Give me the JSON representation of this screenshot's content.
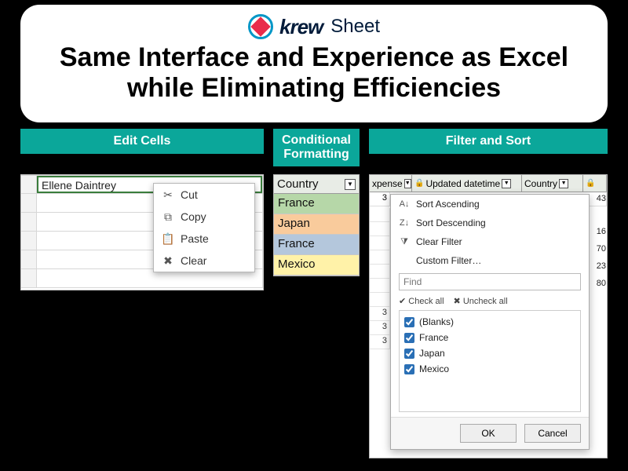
{
  "logo": {
    "brand": "krew",
    "suffix": "Sheet"
  },
  "headline": "Same Interface and Experience as Excel while Eliminating Efficiencies",
  "labels": {
    "edit": "Edit Cells",
    "cond": "Conditional Formatting",
    "filter": "Filter and Sort"
  },
  "edit": {
    "cell_value": "Ellene Daintrey",
    "menu": {
      "cut": "Cut",
      "copy": "Copy",
      "paste": "Paste",
      "clear": "Clear"
    }
  },
  "cond": {
    "header": "Country",
    "rows": [
      "France",
      "Japan",
      "France",
      "Mexico"
    ]
  },
  "filter": {
    "cols": {
      "c1": "xpense",
      "c2": "Updated datetime",
      "c3": "Country"
    },
    "strip": {
      "a": "3",
      "r": "43"
    },
    "right_vals": [
      "43",
      "",
      "16",
      "70",
      "23",
      "80"
    ],
    "bg_left": [
      "",
      "",
      "",
      "",
      "",
      "",
      "",
      "3",
      "3",
      "3"
    ],
    "menu": {
      "sort_asc": "Sort Ascending",
      "sort_desc": "Sort Descending",
      "clear": "Clear Filter",
      "custom": "Custom Filter…",
      "find_ph": "Find",
      "check_all": "Check all",
      "uncheck_all": "Uncheck all",
      "options": [
        "(Blanks)",
        "France",
        "Japan",
        "Mexico"
      ],
      "ok": "OK",
      "cancel": "Cancel"
    }
  }
}
